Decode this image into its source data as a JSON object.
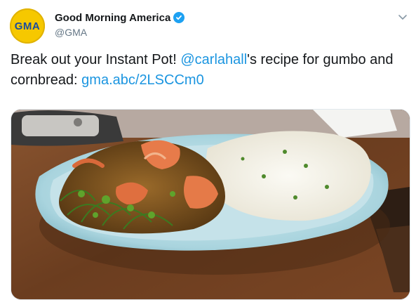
{
  "account": {
    "display_name": "Good Morning America",
    "handle": "@GMA",
    "avatar_text": "GMA"
  },
  "tweet": {
    "text_part1": "Break out your Instant Pot! ",
    "mention": "@carlahall",
    "text_part2": "'s recipe for gumbo and cornbread: ",
    "link": "gma.abc/2LSCCm0"
  },
  "icons": {
    "verified": "verified-badge-icon",
    "menu": "chevron-down-icon"
  },
  "colors": {
    "link": "#1b95e0",
    "verified": "#1da1f2",
    "avatar_bg": "#f6c800",
    "avatar_text": "#1a4d9e"
  },
  "media": {
    "description_visible": false
  }
}
